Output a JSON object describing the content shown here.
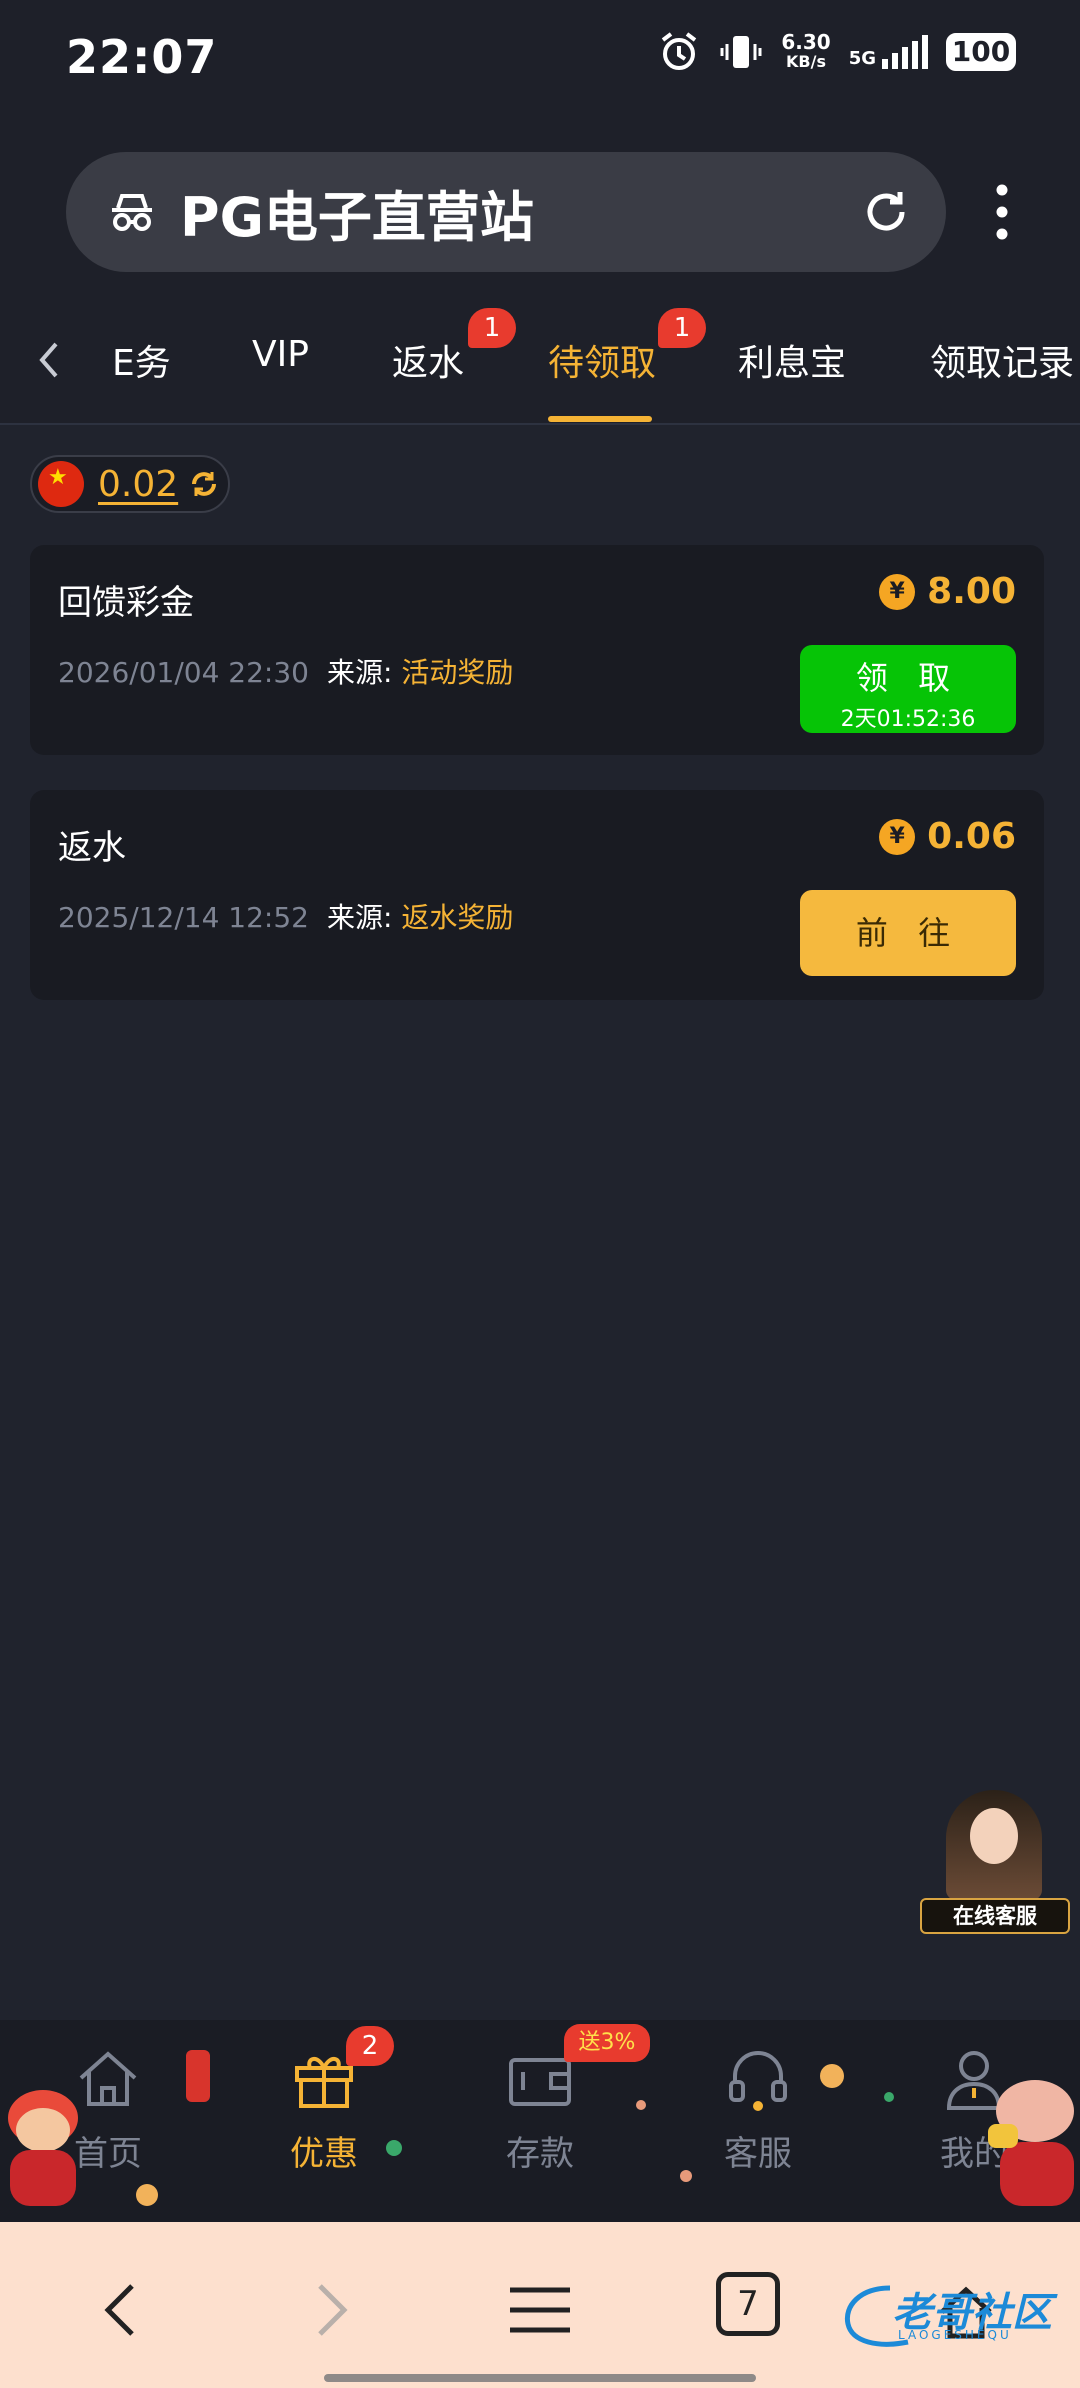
{
  "status_bar": {
    "time": "22:07",
    "net_speed_value": "6.30",
    "net_speed_unit": "KB/s",
    "network": "5G",
    "battery": "100"
  },
  "browser": {
    "site_title": "PG电子直营站"
  },
  "tabs": {
    "items": [
      {
        "label": "任务",
        "visible_label": "E务",
        "badge": ""
      },
      {
        "label": "VIP",
        "badge": ""
      },
      {
        "label": "返水",
        "badge": "1"
      },
      {
        "label": "待领取",
        "badge": "1",
        "active": true
      },
      {
        "label": "利息宝",
        "badge": ""
      },
      {
        "label": "领取记录",
        "badge": ""
      }
    ]
  },
  "balance": {
    "value": "0.02"
  },
  "cards": [
    {
      "title": "回馈彩金",
      "date": "2026/01/04 22:30",
      "source_label": "来源:",
      "source_value": "活动奖励",
      "amount": "8.00",
      "button_label": "领 取",
      "countdown": "2天01:52:36"
    },
    {
      "title": "返水",
      "date": "2025/12/14 12:52",
      "source_label": "来源:",
      "source_value": "返水奖励",
      "amount": "0.06",
      "button_label": "前 往"
    }
  ],
  "coin_symbol": "¥",
  "customer_service": {
    "label": "在线客服"
  },
  "bottom_nav": {
    "items": [
      {
        "label": "首页",
        "icon": "home-icon"
      },
      {
        "label": "优惠",
        "icon": "gift-icon",
        "badge": "2",
        "active": true
      },
      {
        "label": "存款",
        "icon": "wallet-icon",
        "promo": "送3%"
      },
      {
        "label": "客服",
        "icon": "headset-icon"
      },
      {
        "label": "我的",
        "icon": "user-icon"
      }
    ]
  },
  "browser_bar": {
    "tab_count": "7",
    "watermark": "老哥社区",
    "watermark_sub": "LAOGESHEQU"
  },
  "colors": {
    "accent": "#f5b335",
    "claim_green": "#06c406",
    "badge_red": "#e83b2e",
    "background": "#20232d"
  }
}
